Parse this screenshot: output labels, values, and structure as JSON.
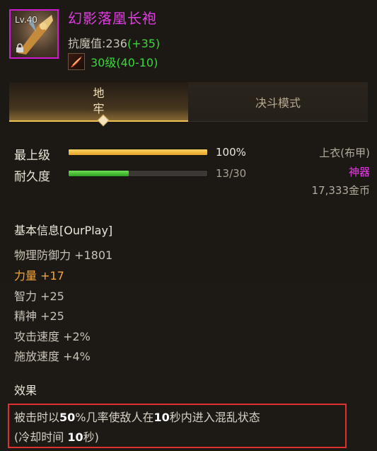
{
  "item": {
    "name": "幻影落凰长袍",
    "level_badge": "Lv.40",
    "stat_label": "抗魔值:",
    "stat_base": "236",
    "stat_bonus": "(+35)",
    "level_req": "30级(40-10)",
    "icon": "robe-item-icon",
    "skill_icon": "phoenix-feather-icon",
    "frame_color": "#d01ad0",
    "name_color": "#e23ce2"
  },
  "tabs": [
    {
      "label": "地牢",
      "active": true
    },
    {
      "label": "决斗模式",
      "active": false
    }
  ],
  "bars": {
    "upgrade": {
      "label": "最上级",
      "value_text": "100%",
      "fraction": 1.0,
      "color": "#f0b83a"
    },
    "durability": {
      "label": "耐久度",
      "value_text": "13/30",
      "fraction": 0.4333,
      "color": "#4cc43a"
    }
  },
  "summary": {
    "slot": "上衣(布甲)",
    "rarity": "神器",
    "price": "17,333金币",
    "rarity_color": "#e23ce2"
  },
  "basic_info": {
    "title": "基本信息[OurPlay]",
    "attributes": [
      "物理防御力 +1801",
      "力量 +17",
      "智力 +25",
      "精神 +25",
      "攻击速度 +2%",
      "施放速度 +4%"
    ]
  },
  "effect": {
    "title": "效果",
    "line1_a": "被击时以",
    "line1_b": "50",
    "line1_c": "%几率使敌人在",
    "line1_d": "10",
    "line1_e": "秒内进入混乱状态",
    "line2_a": "(冷却时间 ",
    "line2_b": "10",
    "line2_c": "秒)"
  }
}
